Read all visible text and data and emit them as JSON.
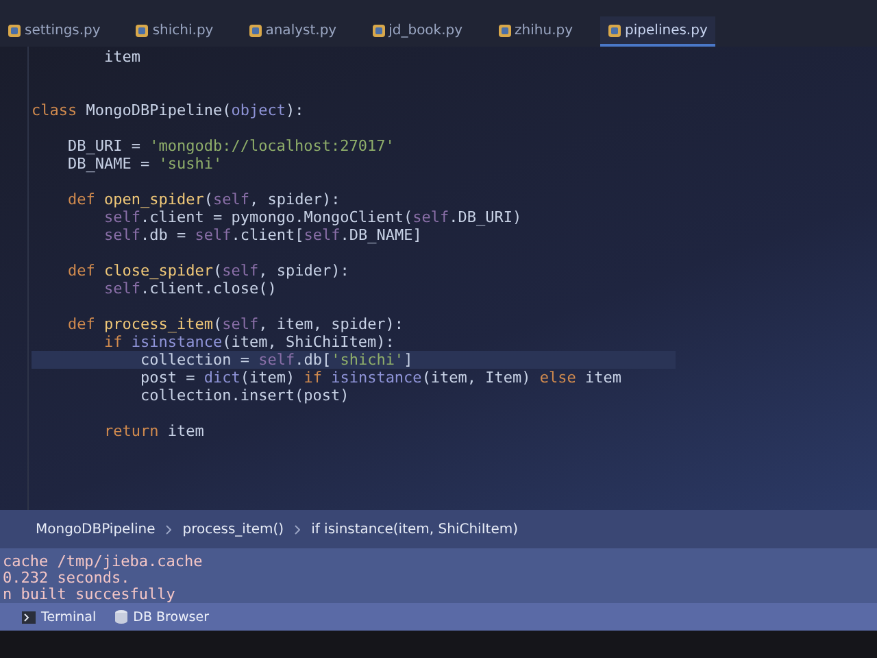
{
  "tabs": [
    {
      "label": "settings.py",
      "selected": false
    },
    {
      "label": "shichi.py",
      "selected": false
    },
    {
      "label": "analyst.py",
      "selected": false
    },
    {
      "label": "jd_book.py",
      "selected": false
    },
    {
      "label": "zhihu.py",
      "selected": false
    },
    {
      "label": "pipelines.py",
      "selected": true
    }
  ],
  "code_lines": [
    {
      "current": false,
      "tokens": [
        {
          "kind": "plain",
          "text": "        item"
        }
      ]
    },
    {
      "current": false
    },
    {
      "current": false
    },
    {
      "current": false,
      "tokens": [
        {
          "kind": "keyword",
          "text": "class "
        },
        {
          "kind": "plain",
          "text": "MongoDBPipeline("
        },
        {
          "kind": "builtin",
          "text": "object"
        },
        {
          "kind": "plain",
          "text": "):"
        }
      ]
    },
    {
      "current": false
    },
    {
      "current": false,
      "tokens": [
        {
          "kind": "plain",
          "text": "    DB_URI = "
        },
        {
          "kind": "string",
          "text": "'mongodb://localhost:27017'"
        }
      ]
    },
    {
      "current": false,
      "tokens": [
        {
          "kind": "plain",
          "text": "    DB_NAME = "
        },
        {
          "kind": "string",
          "text": "'sushi'"
        }
      ]
    },
    {
      "current": false
    },
    {
      "current": false,
      "tokens": [
        {
          "kind": "keyword",
          "text": "    def "
        },
        {
          "kind": "function",
          "text": "open_spider"
        },
        {
          "kind": "plain",
          "text": "("
        },
        {
          "kind": "self",
          "text": "self"
        },
        {
          "kind": "plain",
          "text": ", spider):"
        }
      ]
    },
    {
      "current": false,
      "tokens": [
        {
          "kind": "self",
          "text": "        self"
        },
        {
          "kind": "plain",
          "text": ".client = pymongo.MongoClient("
        },
        {
          "kind": "self",
          "text": "self"
        },
        {
          "kind": "plain",
          "text": ".DB_URI)"
        }
      ]
    },
    {
      "current": false,
      "tokens": [
        {
          "kind": "self",
          "text": "        self"
        },
        {
          "kind": "plain",
          "text": ".db = "
        },
        {
          "kind": "self",
          "text": "self"
        },
        {
          "kind": "plain",
          "text": ".client["
        },
        {
          "kind": "self",
          "text": "self"
        },
        {
          "kind": "plain",
          "text": ".DB_NAME]"
        }
      ]
    },
    {
      "current": false
    },
    {
      "current": false,
      "tokens": [
        {
          "kind": "keyword",
          "text": "    def "
        },
        {
          "kind": "function",
          "text": "close_spider"
        },
        {
          "kind": "plain",
          "text": "("
        },
        {
          "kind": "self",
          "text": "self"
        },
        {
          "kind": "plain",
          "text": ", spider):"
        }
      ]
    },
    {
      "current": false,
      "tokens": [
        {
          "kind": "self",
          "text": "        self"
        },
        {
          "kind": "plain",
          "text": ".client.close()"
        }
      ]
    },
    {
      "current": false
    },
    {
      "current": false,
      "tokens": [
        {
          "kind": "keyword",
          "text": "    def "
        },
        {
          "kind": "function",
          "text": "process_item"
        },
        {
          "kind": "plain",
          "text": "("
        },
        {
          "kind": "self",
          "text": "self"
        },
        {
          "kind": "plain",
          "text": ", item, spider):"
        }
      ]
    },
    {
      "current": false,
      "tokens": [
        {
          "kind": "keyword",
          "text": "        if "
        },
        {
          "kind": "builtin",
          "text": "isinstance"
        },
        {
          "kind": "plain",
          "text": "(item, ShiChiItem):"
        }
      ]
    },
    {
      "current": true,
      "tokens": [
        {
          "kind": "plain",
          "text": "            collection = "
        },
        {
          "kind": "self",
          "text": "self"
        },
        {
          "kind": "plain",
          "text": ".db["
        },
        {
          "kind": "string",
          "text": "'shichi'"
        },
        {
          "kind": "plain",
          "text": "]"
        }
      ]
    },
    {
      "current": false,
      "tokens": [
        {
          "kind": "plain",
          "text": "            post = "
        },
        {
          "kind": "builtin",
          "text": "dict"
        },
        {
          "kind": "plain",
          "text": "(item) "
        },
        {
          "kind": "keyword",
          "text": "if "
        },
        {
          "kind": "builtin",
          "text": "isinstance"
        },
        {
          "kind": "plain",
          "text": "(item, Item) "
        },
        {
          "kind": "keyword",
          "text": "else "
        },
        {
          "kind": "plain",
          "text": "item"
        }
      ]
    },
    {
      "current": false,
      "tokens": [
        {
          "kind": "plain",
          "text": "            collection.insert(post)"
        }
      ]
    },
    {
      "current": false
    },
    {
      "current": false,
      "tokens": [
        {
          "kind": "keyword",
          "text": "        return "
        },
        {
          "kind": "plain",
          "text": "item"
        }
      ]
    }
  ],
  "breadcrumbs": [
    "MongoDBPipeline",
    "process_item()",
    "if isinstance(item, ShiChiItem)"
  ],
  "console_lines": [
    "cache /tmp/jieba.cache",
    "0.232 seconds.",
    "n built succesfully"
  ],
  "tool_tabs": [
    {
      "kind": "terminal",
      "label": "Terminal"
    },
    {
      "kind": "database",
      "label": "DB Browser"
    }
  ]
}
